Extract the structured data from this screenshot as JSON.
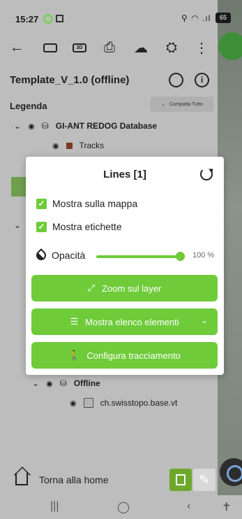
{
  "status_bar": {
    "time": "15:27",
    "battery": "65"
  },
  "toolbar": {
    "back_icon": "arrow-left",
    "btn_2d": "",
    "btn_3d": "3D",
    "print_icon": "printer",
    "cloud_badge": "0",
    "settings_icon": "folder-gear",
    "more_icon": "more-vert"
  },
  "project": {
    "title": "Template_V_1.0 (offline)"
  },
  "legend": {
    "label": "Legenda",
    "collapse_label": "Compatta Tutto",
    "group1": "GI-ANT REDOG Database",
    "layer_tracks": "Tracks",
    "group_offline": "Offline",
    "layer_swisstopo": "ch.swisstopo.base.vt"
  },
  "dialog": {
    "title": "Lines [1]",
    "show_on_map": "Mostra sulla mappa",
    "show_labels": "Mostra etichette",
    "opacity_label": "Opacità",
    "opacity_value": "100 %",
    "opacity_fraction": 1.0,
    "zoom_button": "Zoom sul layer",
    "list_button": "Mostra elenco elementi",
    "tracking_button": "Configura tracciamento"
  },
  "bottom": {
    "home_label": "Torna alla home"
  },
  "colors": {
    "accent": "#6fcb3a",
    "map_active": "#6ea82b"
  }
}
